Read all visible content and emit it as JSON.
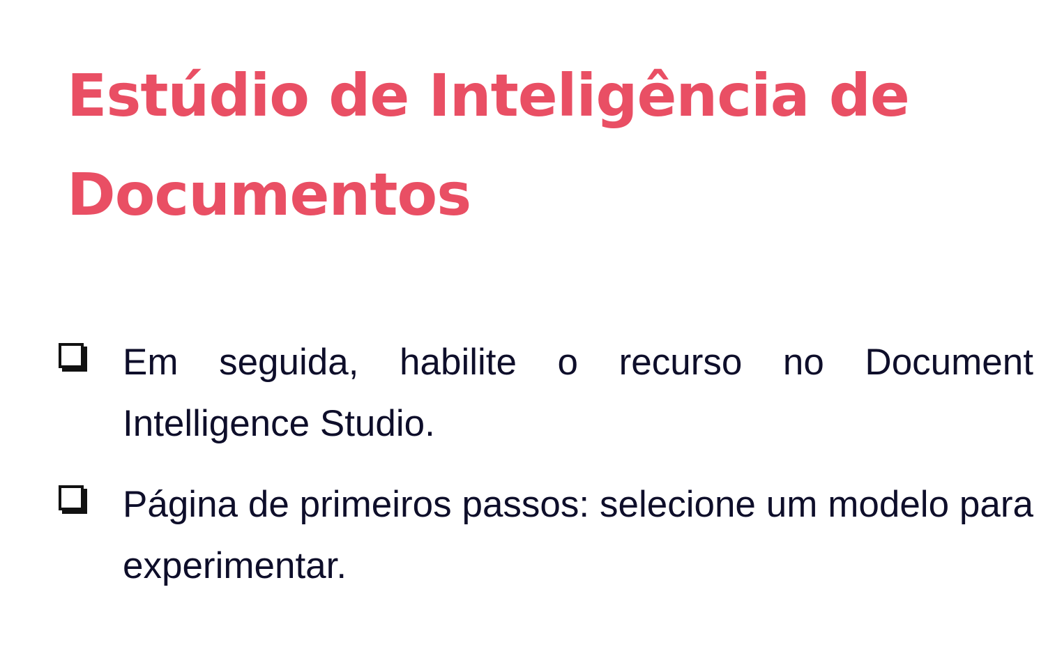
{
  "slide": {
    "title": "Estúdio de Inteligência de Documentos",
    "bullets": [
      {
        "icon": "checkbox-square-icon",
        "text": "Em seguida, habilite o recurso no Document Intelligence Studio."
      },
      {
        "icon": "checkbox-square-icon",
        "text": "Página de primeiros passos: selecione um modelo para experimentar."
      }
    ]
  },
  "colors": {
    "title": "#e94f64",
    "body_text": "#0e0e2a",
    "background": "#ffffff"
  }
}
